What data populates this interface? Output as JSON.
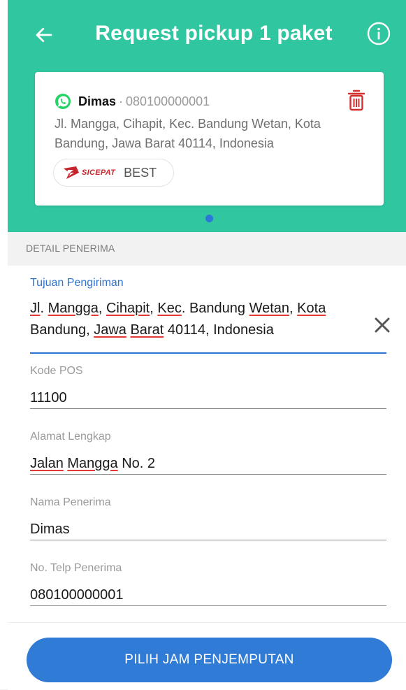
{
  "header": {
    "title": "Request pickup 1 paket",
    "back_icon": "arrow-left-icon",
    "info_icon": "info-circle-icon",
    "background_color": "#30c6a0"
  },
  "package_card": {
    "recipient_name": "Dimas",
    "separator": "·",
    "recipient_phone": "080100000001",
    "address": "Jl. Mangga, Cihapit, Kec. Bandung Wetan, Kota Bandung, Jawa Barat 40114, Indonesia",
    "courier_logo_text": "SICEPAT",
    "courier_service": "BEST",
    "chat_icon": "whatsapp-icon",
    "delete_icon": "trash-icon",
    "delete_icon_color": "#d32f2f"
  },
  "section": {
    "title": "DETAIL PENERIMA"
  },
  "form": {
    "destination": {
      "label": "Tujuan Pengiriman",
      "value": "Jl. Mangga, Cihapit, Kec. Bandung Wetan, Kota Bandung, Jawa Barat 40114, Indonesia",
      "clear_icon": "close-icon"
    },
    "postal_code": {
      "label": "Kode POS",
      "value": "11100"
    },
    "full_address": {
      "label": "Alamat Lengkap",
      "value": "Jalan Mangga No. 2"
    },
    "recipient_name": {
      "label": "Nama Penerima",
      "value": "Dimas"
    },
    "recipient_phone": {
      "label": "No. Telp Penerima",
      "value": "080100000001"
    }
  },
  "cta": {
    "label": "PILIH JAM PENJEMPUTAN",
    "color": "#2f7bd6"
  }
}
